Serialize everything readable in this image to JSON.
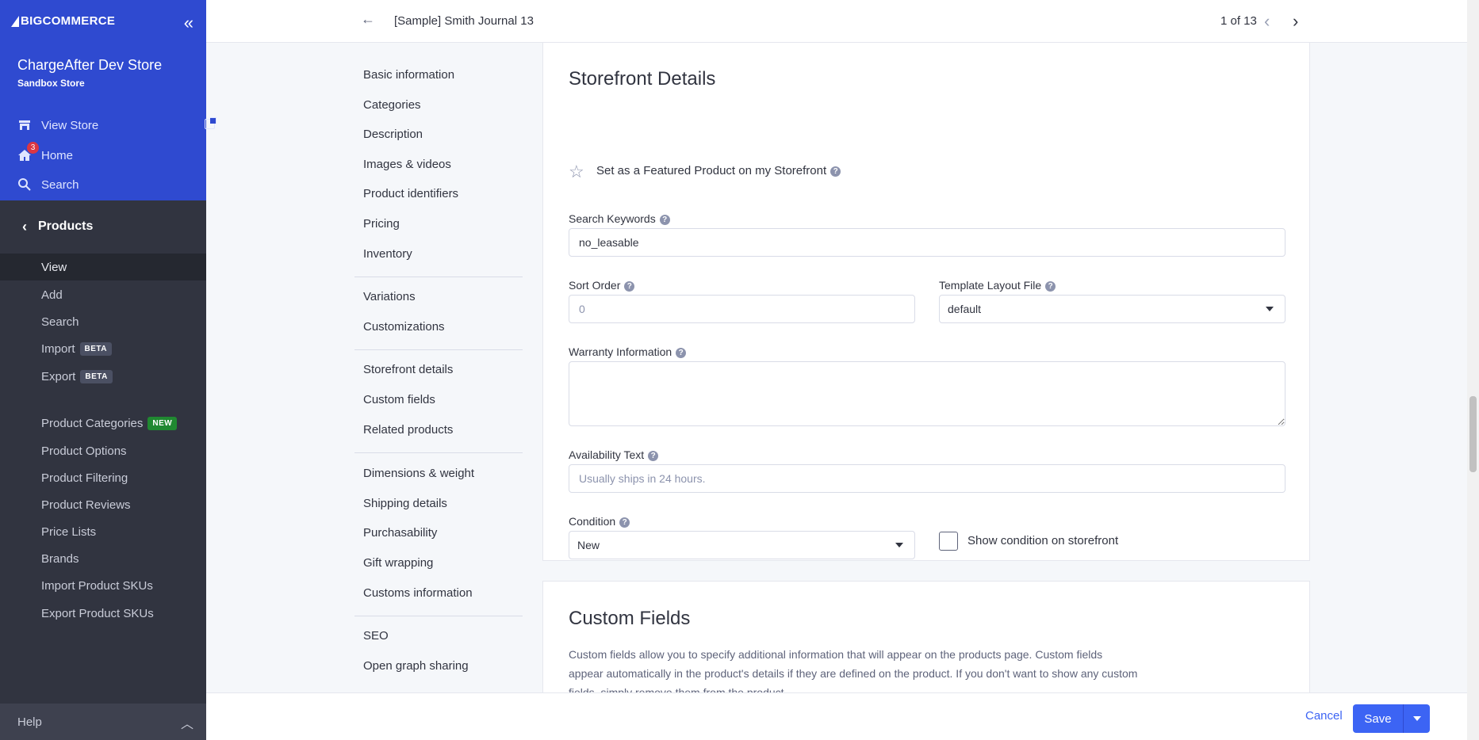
{
  "sidebar": {
    "brand": "BIGCOMMERCE",
    "store_name": "ChargeAfter Dev Store",
    "store_type": "Sandbox Store",
    "view_store": "View Store",
    "home": "Home",
    "home_badge": "3",
    "search": "Search",
    "section": "Products",
    "items": [
      {
        "label": "View"
      },
      {
        "label": "Add"
      },
      {
        "label": "Search"
      },
      {
        "label": "Import",
        "tag": "BETA"
      },
      {
        "label": "Export",
        "tag": "BETA"
      },
      {
        "label": "Product Categories",
        "tag": "NEW"
      },
      {
        "label": "Product Options"
      },
      {
        "label": "Product Filtering"
      },
      {
        "label": "Product Reviews"
      },
      {
        "label": "Price Lists"
      },
      {
        "label": "Brands"
      },
      {
        "label": "Import Product SKUs"
      },
      {
        "label": "Export Product SKUs"
      }
    ],
    "help": "Help"
  },
  "header": {
    "title": "[Sample] Smith Journal 13",
    "pager": "1 of 13"
  },
  "subnav": [
    "Basic information",
    "Categories",
    "Description",
    "Images & videos",
    "Product identifiers",
    "Pricing",
    "Inventory",
    "Variations",
    "Customizations",
    "Storefront details",
    "Custom fields",
    "Related products",
    "Dimensions & weight",
    "Shipping details",
    "Purchasability",
    "Gift wrapping",
    "Customs information",
    "SEO",
    "Open graph sharing"
  ],
  "storefront": {
    "heading": "Storefront Details",
    "featured_label": "Set as a Featured Product on my Storefront",
    "search_keywords_label": "Search Keywords",
    "search_keywords_value": "no_leasable",
    "sort_order_label": "Sort Order",
    "sort_order_placeholder": "0",
    "template_label": "Template Layout File",
    "template_value": "default",
    "warranty_label": "Warranty Information",
    "availability_label": "Availability Text",
    "availability_placeholder": "Usually ships in 24 hours.",
    "condition_label": "Condition",
    "condition_value": "New",
    "show_condition_label": "Show condition on storefront"
  },
  "custom_fields": {
    "heading": "Custom Fields",
    "description": "Custom fields allow you to specify additional information that will appear on the products page. Custom fields appear automatically in the product's details if they are defined on the product. If you don't want to show any custom fields, simply remove them from the product."
  },
  "footer": {
    "cancel": "Cancel",
    "save": "Save"
  },
  "help_glyph": "?",
  "colors": {
    "sidebar_top": "#2f4ad0",
    "sidebar": "#313440",
    "primary": "#3c64f4",
    "new_badge": "#208831",
    "alert_badge": "#db3643"
  }
}
